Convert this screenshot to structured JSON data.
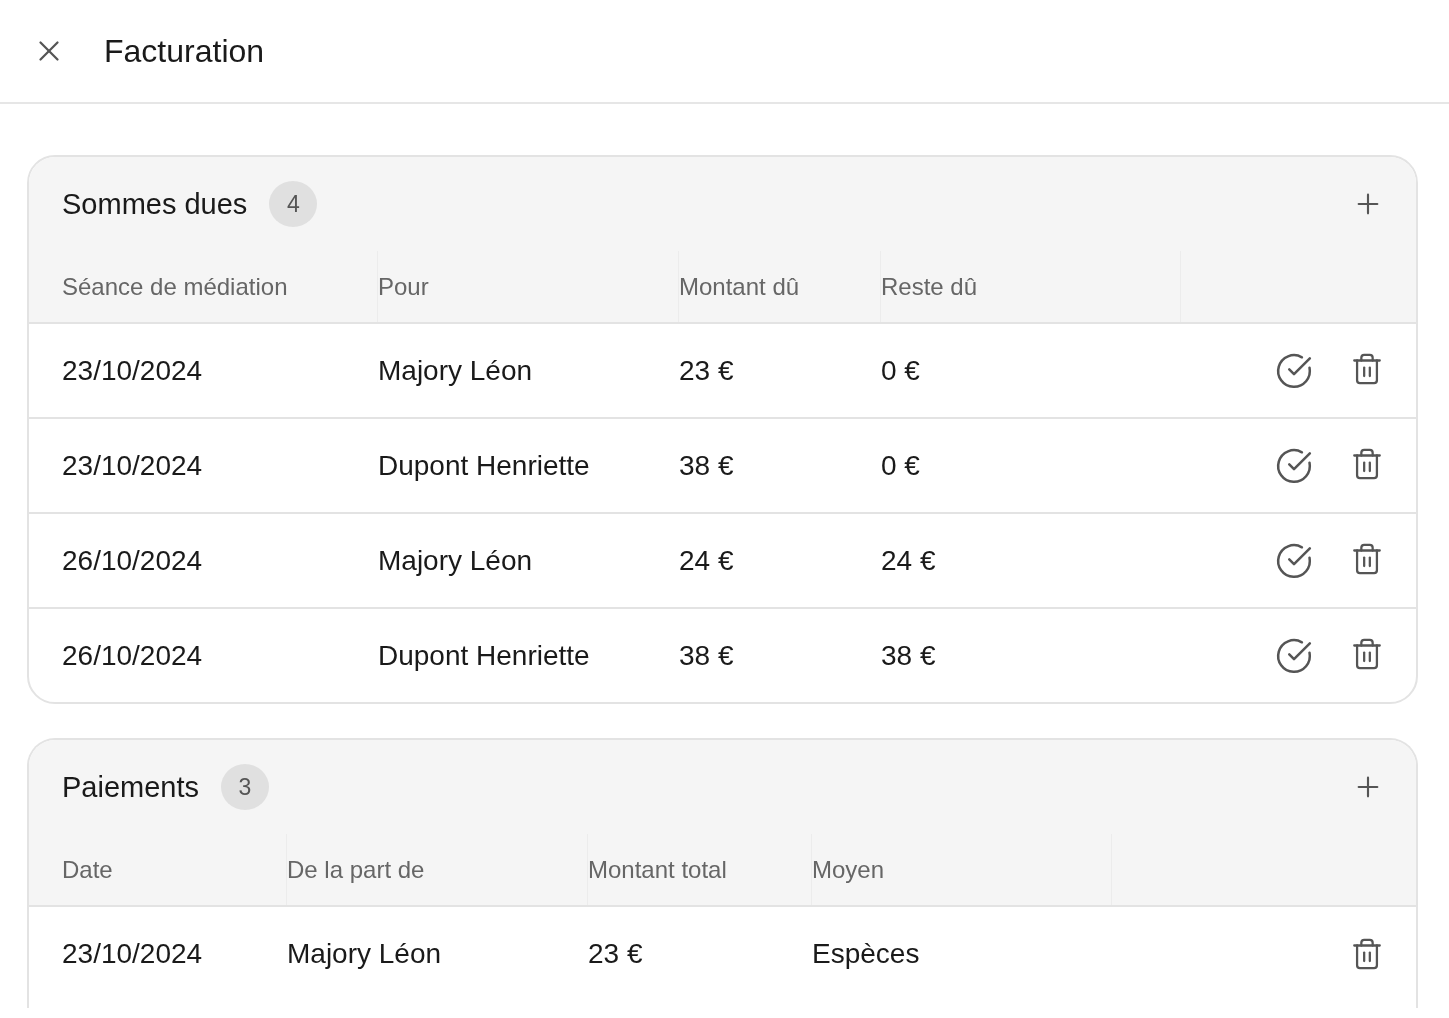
{
  "header": {
    "title": "Facturation"
  },
  "sections": [
    {
      "title": "Sommes dues",
      "count": "4",
      "columns": [
        "Séance de médiation",
        "Pour",
        "Montant dû",
        "Reste dû"
      ],
      "actions": [
        {
          "kind": "validate"
        },
        {
          "kind": "delete"
        }
      ],
      "rows": [
        {
          "cells": [
            "23/10/2024",
            "Majory Léon",
            "23 €",
            "0 €"
          ]
        },
        {
          "cells": [
            "23/10/2024",
            "Dupont Henriette",
            "38 €",
            "0 €"
          ]
        },
        {
          "cells": [
            "26/10/2024",
            "Majory Léon",
            "24 €",
            "24 €"
          ]
        },
        {
          "cells": [
            "26/10/2024",
            "Dupont Henriette",
            "38 €",
            "38 €"
          ]
        }
      ]
    },
    {
      "title": "Paiements",
      "count": "3",
      "columns": [
        "Date",
        "De la part de",
        "Montant total",
        "Moyen"
      ],
      "actions": [
        {
          "kind": "delete"
        }
      ],
      "rows": [
        {
          "cells": [
            "23/10/2024",
            "Majory Léon",
            "23 €",
            "Espèces"
          ]
        }
      ]
    }
  ]
}
